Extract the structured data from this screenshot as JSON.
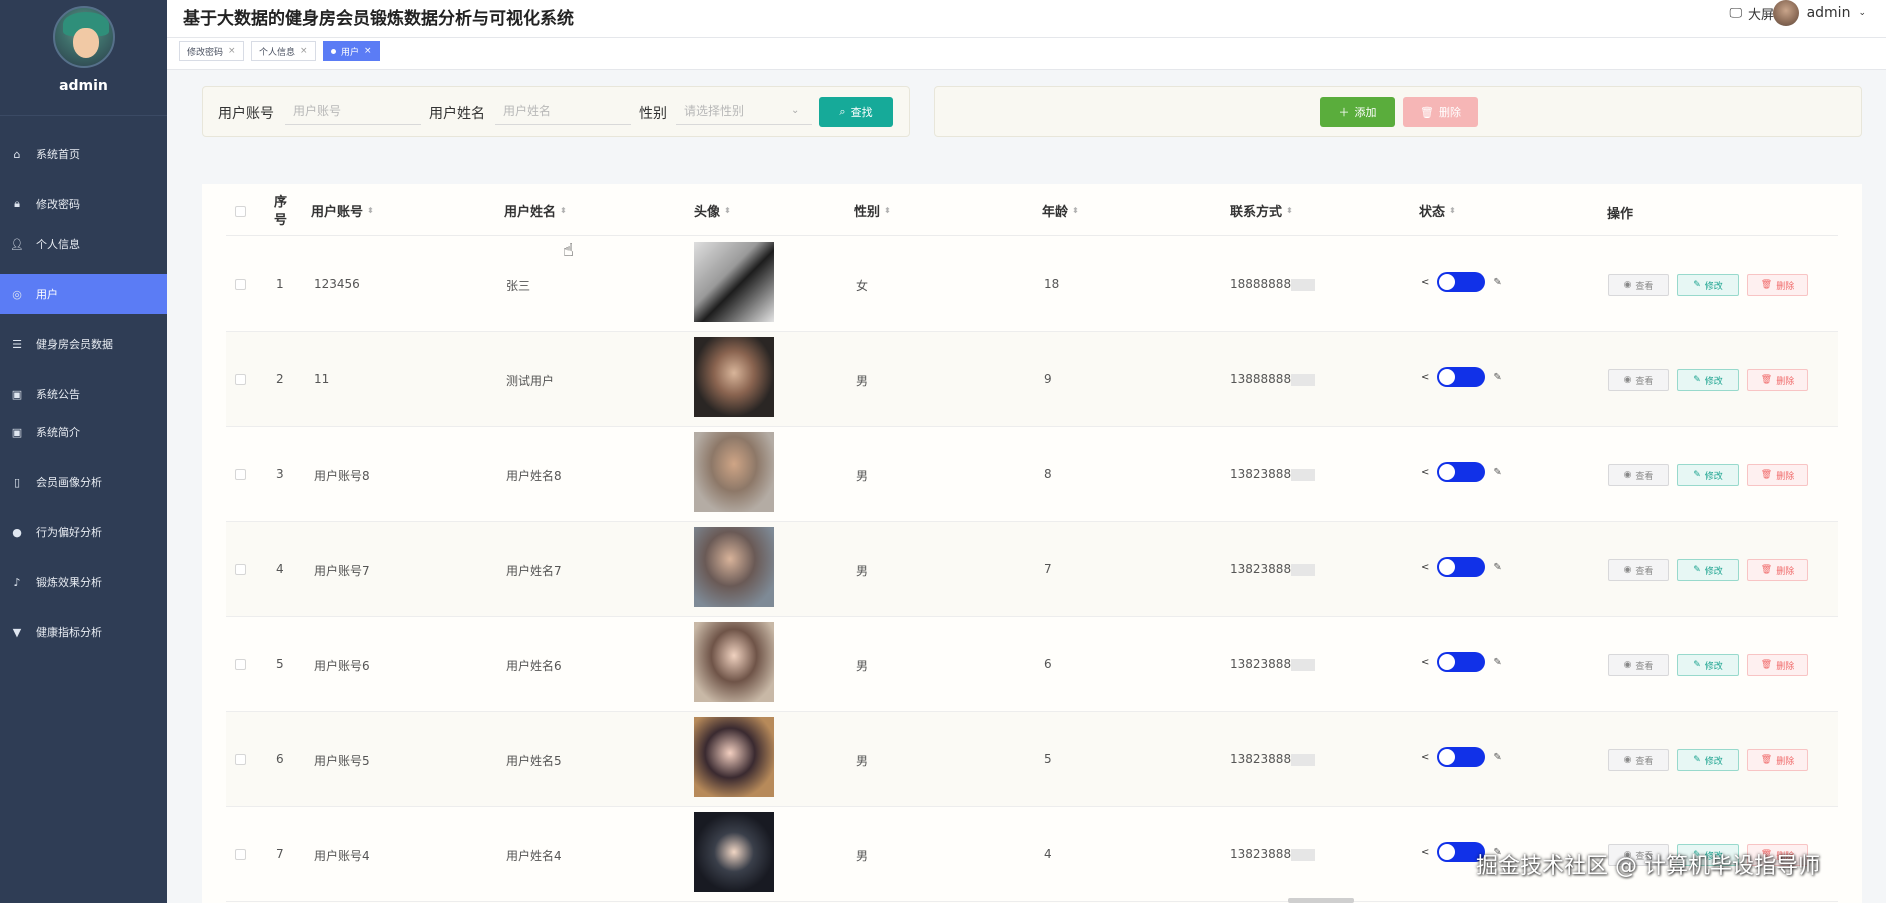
{
  "app": {
    "title": "基于大数据的健身房会员锻炼数据分析与可视化系统",
    "big_screen_label": "大屏",
    "user_name": "admin"
  },
  "sidebar": {
    "profile_name": "admin",
    "items": [
      {
        "label": "系统首页",
        "icon": "home-icon"
      },
      {
        "label": "修改密码",
        "icon": "lock-icon"
      },
      {
        "label": "个人信息",
        "icon": "user-icon"
      },
      {
        "label": "用户",
        "icon": "users-icon",
        "active": true
      },
      {
        "label": "健身房会员数据",
        "icon": "sliders-icon"
      },
      {
        "label": "系统公告",
        "icon": "clipboard-icon"
      },
      {
        "label": "系统简介",
        "icon": "clipboard-icon"
      },
      {
        "label": "会员画像分析",
        "icon": "phone-icon"
      },
      {
        "label": "行为偏好分析",
        "icon": "bulb-icon"
      },
      {
        "label": "锻炼效果分析",
        "icon": "bell-icon"
      },
      {
        "label": "健康指标分析",
        "icon": "trophy-icon"
      }
    ],
    "accent": "#5b7cf5",
    "bg": "#2f3d55"
  },
  "tabs": [
    {
      "label": "修改密码"
    },
    {
      "label": "个人信息"
    },
    {
      "label": "用户",
      "active": true
    }
  ],
  "search": {
    "account_label": "用户账号",
    "account_placeholder": "用户账号",
    "name_label": "用户姓名",
    "name_placeholder": "用户姓名",
    "gender_label": "性别",
    "gender_placeholder": "请选择性别",
    "search_button": "查找"
  },
  "actions": {
    "add_button": "添加",
    "delete_button": "删除"
  },
  "table": {
    "headers": {
      "seq": "序号",
      "account": "用户账号",
      "name": "用户姓名",
      "photo": "头像",
      "gender": "性别",
      "age": "年龄",
      "phone": "联系方式",
      "status": "状态",
      "ops": "操作"
    },
    "op_labels": {
      "view": "查看",
      "edit": "修改",
      "delete": "删除"
    },
    "rows": [
      {
        "seq": "1",
        "account": "123456",
        "name": "张三",
        "gender": "女",
        "age": "18",
        "phone": "18888888"
      },
      {
        "seq": "2",
        "account": "11",
        "name": "测试用户",
        "gender": "男",
        "age": "9",
        "phone": "13888888"
      },
      {
        "seq": "3",
        "account": "用户账号8",
        "name": "用户姓名8",
        "gender": "男",
        "age": "8",
        "phone": "13823888"
      },
      {
        "seq": "4",
        "account": "用户账号7",
        "name": "用户姓名7",
        "gender": "男",
        "age": "7",
        "phone": "13823888"
      },
      {
        "seq": "5",
        "account": "用户账号6",
        "name": "用户姓名6",
        "gender": "男",
        "age": "6",
        "phone": "13823888"
      },
      {
        "seq": "6",
        "account": "用户账号5",
        "name": "用户姓名5",
        "gender": "男",
        "age": "5",
        "phone": "13823888"
      },
      {
        "seq": "7",
        "account": "用户账号4",
        "name": "用户姓名4",
        "gender": "男",
        "age": "4",
        "phone": "13823888"
      }
    ]
  },
  "watermark": "掘金技术社区 @ 计算机毕设指导师"
}
